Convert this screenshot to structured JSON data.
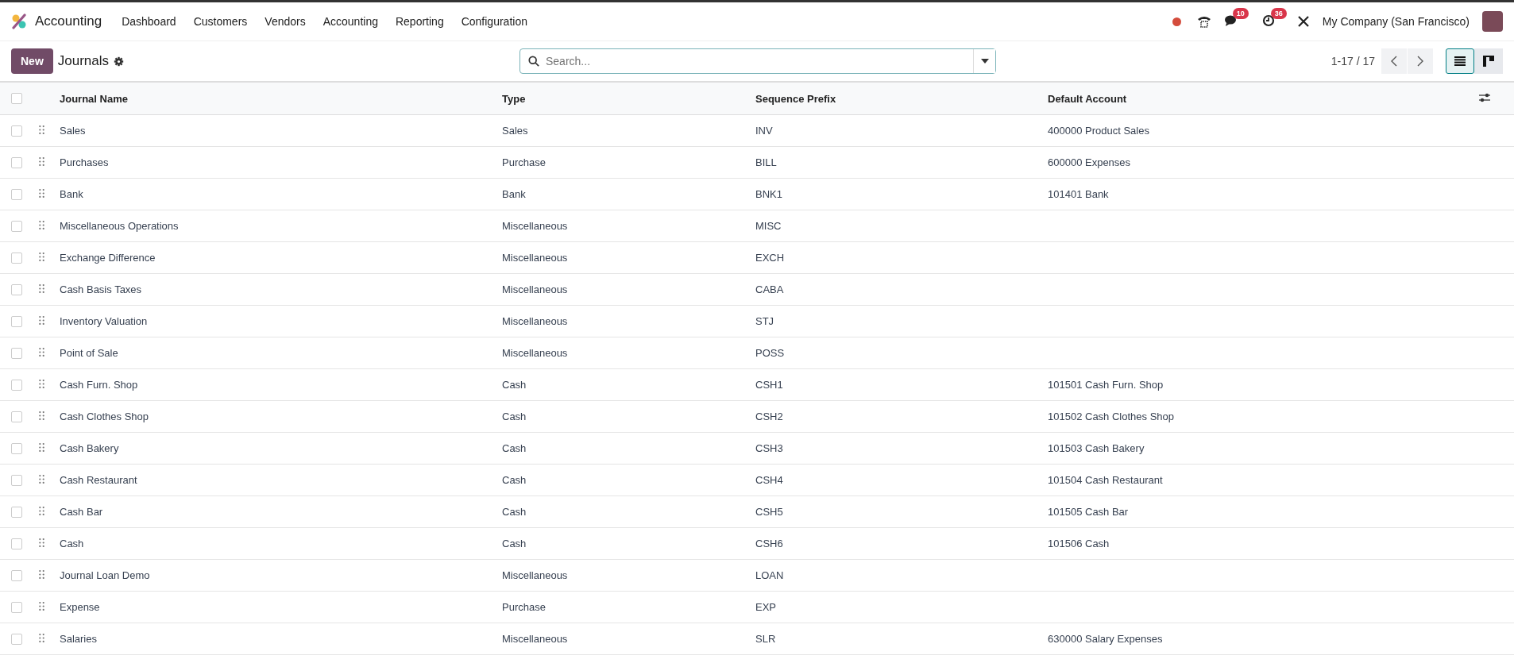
{
  "navbar": {
    "app_name": "Accounting",
    "menu": [
      "Dashboard",
      "Customers",
      "Vendors",
      "Accounting",
      "Reporting",
      "Configuration"
    ],
    "chat_badge": "10",
    "activity_badge": "36",
    "company": "My Company (San Francisco)"
  },
  "control_panel": {
    "new_button": "New",
    "title": "Journals",
    "search": {
      "placeholder": "Search..."
    },
    "pager": "1-17 / 17",
    "views": [
      {
        "kind": "list",
        "selected": true
      },
      {
        "kind": "kanban",
        "selected": false
      }
    ]
  },
  "table": {
    "select_all_checked": false,
    "columns": [
      "Journal Name",
      "Type",
      "Sequence Prefix",
      "Default Account"
    ],
    "rows": [
      {
        "checked": false,
        "name": "Sales",
        "type": "Sales",
        "prefix": "INV",
        "account": "400000 Product Sales"
      },
      {
        "checked": false,
        "name": "Purchases",
        "type": "Purchase",
        "prefix": "BILL",
        "account": "600000 Expenses"
      },
      {
        "checked": false,
        "name": "Bank",
        "type": "Bank",
        "prefix": "BNK1",
        "account": "101401 Bank"
      },
      {
        "checked": false,
        "name": "Miscellaneous Operations",
        "type": "Miscellaneous",
        "prefix": "MISC"
      },
      {
        "checked": false,
        "name": "Exchange Difference",
        "type": "Miscellaneous",
        "prefix": "EXCH"
      },
      {
        "checked": false,
        "name": "Cash Basis Taxes",
        "type": "Miscellaneous",
        "prefix": "CABA"
      },
      {
        "checked": false,
        "name": "Inventory Valuation",
        "type": "Miscellaneous",
        "prefix": "STJ"
      },
      {
        "checked": false,
        "name": "Point of Sale",
        "type": "Miscellaneous",
        "prefix": "POSS"
      },
      {
        "checked": false,
        "name": "Cash Furn. Shop",
        "type": "Cash",
        "prefix": "CSH1",
        "account": "101501 Cash Furn. Shop"
      },
      {
        "checked": false,
        "name": "Cash Clothes Shop",
        "type": "Cash",
        "prefix": "CSH2",
        "account": "101502 Cash Clothes Shop"
      },
      {
        "checked": false,
        "name": "Cash Bakery",
        "type": "Cash",
        "prefix": "CSH3",
        "account": "101503 Cash Bakery"
      },
      {
        "checked": false,
        "name": "Cash Restaurant",
        "type": "Cash",
        "prefix": "CSH4",
        "account": "101504 Cash Restaurant"
      },
      {
        "checked": false,
        "name": "Cash Bar",
        "type": "Cash",
        "prefix": "CSH5",
        "account": "101505 Cash Bar"
      },
      {
        "checked": false,
        "name": "Cash",
        "type": "Cash",
        "prefix": "CSH6",
        "account": "101506 Cash"
      },
      {
        "checked": false,
        "name": "Journal Loan Demo",
        "type": "Miscellaneous",
        "prefix": "LOAN"
      },
      {
        "checked": false,
        "name": "Expense",
        "type": "Purchase",
        "prefix": "EXP"
      },
      {
        "checked": false,
        "name": "Salaries",
        "type": "Miscellaneous",
        "prefix": "SLR",
        "account": "630000 Salary Expenses"
      }
    ]
  }
}
